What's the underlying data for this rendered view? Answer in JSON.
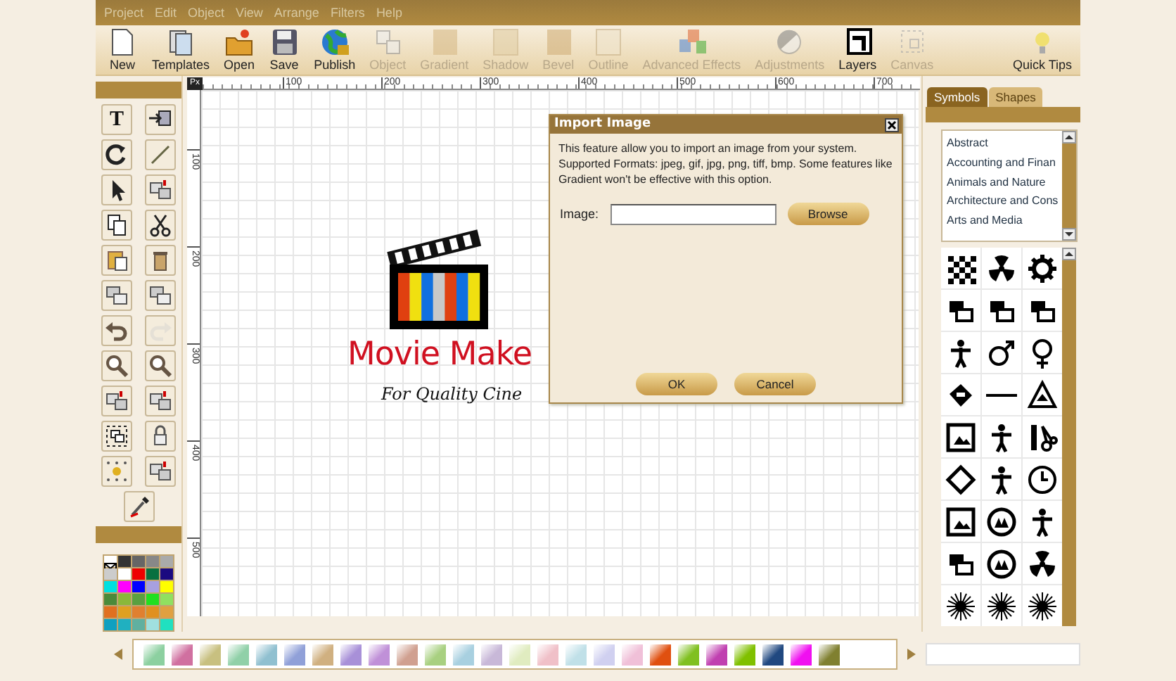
{
  "menu": [
    "Project",
    "Edit",
    "Object",
    "View",
    "Arrange",
    "Filters",
    "Help"
  ],
  "toolbar": [
    {
      "kind": "new",
      "label": "New",
      "disabled": false
    },
    {
      "kind": "templates",
      "label": "Templates",
      "disabled": false
    },
    {
      "kind": "open",
      "label": "Open",
      "disabled": false
    },
    {
      "kind": "save",
      "label": "Save",
      "disabled": false
    },
    {
      "kind": "publish",
      "label": "Publish",
      "disabled": false
    },
    {
      "kind": "object",
      "label": "Object",
      "disabled": true
    },
    {
      "kind": "gradient",
      "label": "Gradient",
      "disabled": true
    },
    {
      "kind": "shadow",
      "label": "Shadow",
      "disabled": true
    },
    {
      "kind": "bevel",
      "label": "Bevel",
      "disabled": true
    },
    {
      "kind": "outline",
      "label": "Outline",
      "disabled": true
    },
    {
      "kind": "effects",
      "label": "Advanced Effects",
      "disabled": true
    },
    {
      "kind": "adjustments",
      "label": "Adjustments",
      "disabled": true
    },
    {
      "kind": "layers",
      "label": "Layers",
      "disabled": false
    },
    {
      "kind": "canvas",
      "label": "Canvas",
      "disabled": true
    },
    {
      "kind": "tips",
      "label": "Quick Tips",
      "disabled": false
    }
  ],
  "tools": [
    {
      "kind": "text",
      "glyph": "T",
      "disabled": false
    },
    {
      "kind": "import",
      "disabled": false
    },
    {
      "kind": "rotate",
      "disabled": false
    },
    {
      "kind": "line",
      "disabled": false
    },
    {
      "kind": "pointer",
      "disabled": false
    },
    {
      "kind": "boxes",
      "disabled": false
    },
    {
      "kind": "copy",
      "disabled": false
    },
    {
      "kind": "cut",
      "disabled": false
    },
    {
      "kind": "paste",
      "disabled": false
    },
    {
      "kind": "delete",
      "disabled": false
    },
    {
      "kind": "layers",
      "disabled": false
    },
    {
      "kind": "layers",
      "disabled": false
    },
    {
      "kind": "undo",
      "disabled": false
    },
    {
      "kind": "redo",
      "disabled": true
    },
    {
      "kind": "zoom",
      "disabled": false
    },
    {
      "kind": "zoom",
      "disabled": false
    },
    {
      "kind": "boxes",
      "disabled": false
    },
    {
      "kind": "boxes",
      "disabled": false
    },
    {
      "kind": "frame",
      "disabled": false
    },
    {
      "kind": "lock",
      "disabled": false
    },
    {
      "kind": "dots",
      "disabled": false
    },
    {
      "kind": "boxes",
      "disabled": false
    },
    {
      "kind": "eyedropper",
      "disabled": false
    }
  ],
  "palette": [
    {
      "color": "#ffffff",
      "kind": "none"
    },
    {
      "color": "#333333"
    },
    {
      "color": "#666666"
    },
    {
      "color": "#888888"
    },
    {
      "color": "#aaaaaa"
    },
    {
      "color": "#cccccc"
    },
    {
      "color": "#ffffff"
    },
    {
      "color": "#ee0000"
    },
    {
      "color": "#087040"
    },
    {
      "color": "#1a0a80"
    },
    {
      "color": "#00e0e0"
    },
    {
      "color": "#ff00ff"
    },
    {
      "color": "#0000ff"
    },
    {
      "color": "#a8a0e0"
    },
    {
      "color": "#ffff00"
    },
    {
      "color": "#4a8a3a"
    },
    {
      "color": "#8ab83a"
    },
    {
      "color": "#5aa040"
    },
    {
      "color": "#20e020"
    },
    {
      "color": "#90e060"
    },
    {
      "color": "#e07020"
    },
    {
      "color": "#e0a020"
    },
    {
      "color": "#e08030"
    },
    {
      "color": "#e09020"
    },
    {
      "color": "#e0a040"
    },
    {
      "color": "#10a0c0"
    },
    {
      "color": "#20b0c0"
    },
    {
      "color": "#60b0a0"
    },
    {
      "color": "#a0e0e0"
    },
    {
      "color": "#20e0c0"
    }
  ],
  "ruler": {
    "corner": "Px",
    "x_labels": [
      "100",
      "200",
      "300",
      "400",
      "500",
      "600",
      "700"
    ],
    "y_labels": [
      "100",
      "200",
      "300",
      "400",
      "500"
    ]
  },
  "logo": {
    "title": "Movie Make",
    "tagline": "For Quality Cine"
  },
  "dialog": {
    "title": "Import Image",
    "text": "This feature allow you to import an image from your system. Supported Formats: jpeg, gif, jpg, png, tiff, bmp. Some features like Gradient won't be effective with this option.",
    "field_label": "Image:",
    "browse": "Browse",
    "ok": "OK",
    "cancel": "Cancel"
  },
  "side": {
    "tabs": [
      {
        "label": "Symbols",
        "selected": true
      },
      {
        "label": "Shapes",
        "selected": false
      }
    ],
    "categories": [
      "Abstract",
      "Accounting and Finan",
      "Animals and Nature",
      "Architecture and Cons",
      "Arts and Media"
    ],
    "symbols": [
      {
        "kind": "checker"
      },
      {
        "kind": "trefoil"
      },
      {
        "kind": "gear"
      },
      {
        "kind": "stack"
      },
      {
        "kind": "stack"
      },
      {
        "kind": "stack"
      },
      {
        "kind": "figure"
      },
      {
        "kind": "male"
      },
      {
        "kind": "female"
      },
      {
        "kind": "tag"
      },
      {
        "kind": "line"
      },
      {
        "kind": "triangle"
      },
      {
        "kind": "frame"
      },
      {
        "kind": "figure"
      },
      {
        "kind": "scissors"
      },
      {
        "kind": "diamond"
      },
      {
        "kind": "figure"
      },
      {
        "kind": "clock"
      },
      {
        "kind": "frame"
      },
      {
        "kind": "circle"
      },
      {
        "kind": "figure"
      },
      {
        "kind": "stack"
      },
      {
        "kind": "circle"
      },
      {
        "kind": "trefoil"
      },
      {
        "kind": "sun"
      },
      {
        "kind": "sun"
      },
      {
        "kind": "sun"
      }
    ]
  },
  "gradients": [
    {
      "color": "#8cd0a0"
    },
    {
      "color": "#d070a0"
    },
    {
      "color": "#c8c080"
    },
    {
      "color": "#90d0a8"
    },
    {
      "color": "#90c0d0"
    },
    {
      "color": "#90a0d8"
    },
    {
      "color": "#d0b080"
    },
    {
      "color": "#a890d8"
    },
    {
      "color": "#c090d8"
    },
    {
      "color": "#d0a090"
    },
    {
      "color": "#a8d080"
    },
    {
      "color": "#a8d0e0"
    },
    {
      "color": "#c8b8d8"
    },
    {
      "color": "#e0ecc0"
    },
    {
      "color": "#f0c0c8"
    },
    {
      "color": "#c0e0e8"
    },
    {
      "color": "#d0d0f0"
    },
    {
      "color": "#f0c0d8"
    },
    {
      "color": "#e05010"
    },
    {
      "color": "#80c020"
    },
    {
      "color": "#c040b0"
    },
    {
      "color": "#80c000"
    },
    {
      "color": "#204880"
    },
    {
      "color": "#f010f0"
    },
    {
      "color": "#808030"
    }
  ]
}
